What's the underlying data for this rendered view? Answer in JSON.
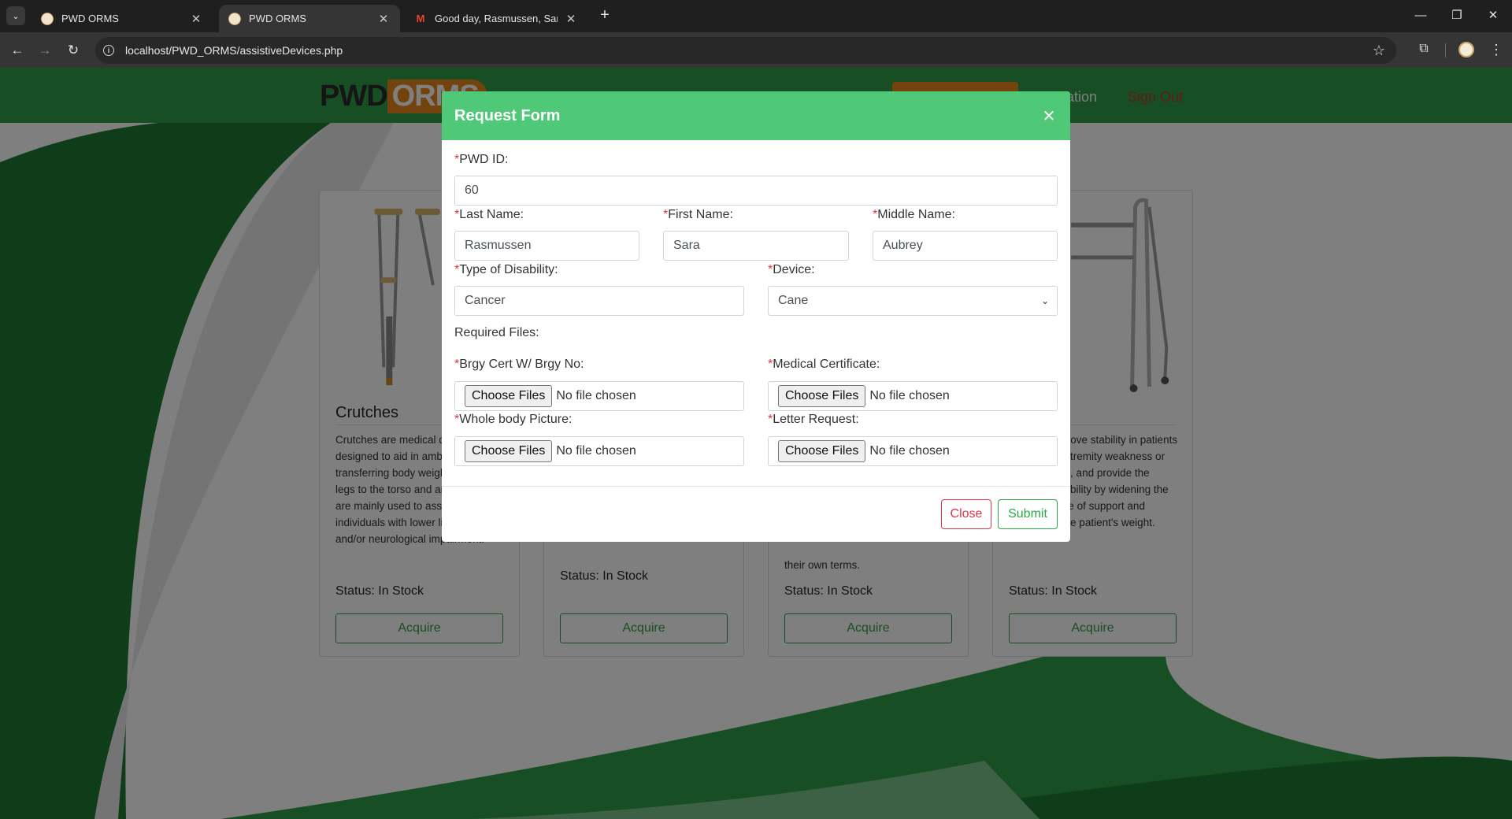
{
  "browser": {
    "tabs": [
      {
        "title": "PWD ORMS",
        "active": false
      },
      {
        "title": "PWD ORMS",
        "active": true
      },
      {
        "title": "Good day, Rasmussen, Sara Au",
        "active": false
      }
    ],
    "url": "localhost/PWD_ORMS/assistiveDevices.php"
  },
  "site": {
    "logo_left": "PWD",
    "logo_right": "ORMS",
    "nav_partial": "cation",
    "signout": "Sign Out",
    "colors": {
      "nav": "#2f9d46",
      "accent": "#e8861a",
      "modal_header": "#4fc878"
    }
  },
  "cards": [
    {
      "title": "Crutches",
      "description": "Crutches are medical devices designed to aid in ambulation by transferring body weight from the legs to the torso and arms. They are mainly used to assist individuals with lower limb injuries and/or neurological impairment.",
      "status": "Status: In Stock",
      "button": "Acquire"
    },
    {
      "title": "",
      "description": "",
      "status": "Status: In Stock",
      "button": "Acquire"
    },
    {
      "title": "",
      "description": "their own terms.",
      "status": "Status: In Stock",
      "button": "Acquire"
    },
    {
      "title": "",
      "description": "Walkers improve stability in patients with lower extremity weakness or poor balance, and provide the improved mobility by widening the patient's base of support and supporting the patient's weight.",
      "status": "Status: In Stock",
      "button": "Acquire"
    }
  ],
  "modal": {
    "title": "Request Form",
    "required_mark": "*",
    "labels": {
      "pwd_id": "PWD ID:",
      "last_name": "Last Name:",
      "first_name": "First Name:",
      "middle_name": "Middle Name:",
      "disability": "Type of Disability:",
      "device": "Device:",
      "required_files": "Required Files:",
      "brgy_cert": "Brgy Cert W/ Brgy No:",
      "medical_cert": "Medical Certificate:",
      "whole_body": "Whole body Picture:",
      "letter_request": "Letter Request:"
    },
    "values": {
      "pwd_id": "60",
      "last_name": "Rasmussen",
      "first_name": "Sara",
      "middle_name": "Aubrey",
      "disability": "Cancer",
      "device": "Cane"
    },
    "file_button": "Choose Files",
    "no_file": "No file chosen",
    "close_button": "Close",
    "submit_button": "Submit"
  }
}
